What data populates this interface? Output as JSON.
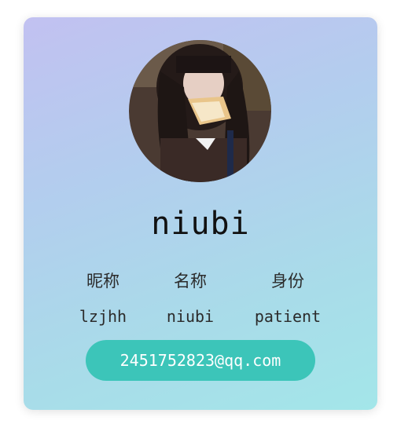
{
  "profile": {
    "avatar_icon": "user-avatar-photo",
    "username": "niubi",
    "fields": [
      {
        "label": "昵称",
        "value": "lzjhh"
      },
      {
        "label": "名称",
        "value": "niubi"
      },
      {
        "label": "身份",
        "value": "patient"
      }
    ],
    "email": "2451752823@qq.com"
  },
  "colors": {
    "accent": "#3cc5b9",
    "card_gradient_start": "#c2c1f1",
    "card_gradient_end": "#a3e6e9"
  }
}
